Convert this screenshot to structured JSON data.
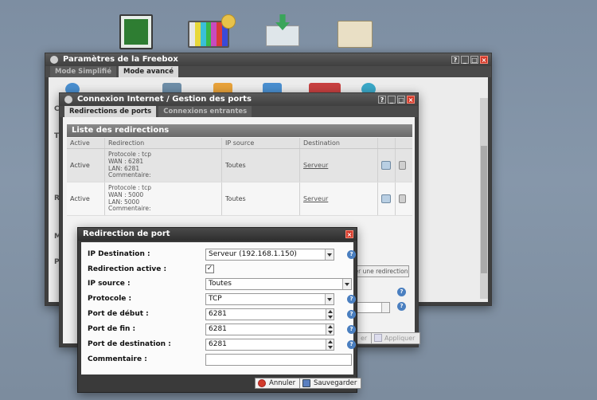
{
  "desktop": {
    "icons": [
      "monitor-icon",
      "tv-icon",
      "mail-download-icon",
      "folder-icon"
    ]
  },
  "freebox_window": {
    "title": "Paramètres de la Freebox",
    "tabs": [
      "Mode Simplifié",
      "Mode avancé"
    ],
    "controls": [
      "?",
      "_",
      "□",
      "×"
    ],
    "side_letters": [
      "C",
      "T",
      "R",
      "M",
      "P"
    ]
  },
  "connexion_window": {
    "title": "Connexion Internet / Gestion des ports",
    "tabs": [
      "Redirections de ports",
      "Connexions entrantes"
    ],
    "controls": [
      "?",
      "_",
      "□",
      "×"
    ],
    "section_title": "Liste des redirections",
    "columns": [
      "Active",
      "Redirection",
      "IP source",
      "Destination"
    ],
    "rows": [
      {
        "active": "Active",
        "redirection": [
          "Protocole : tcp",
          "WAN : 6281",
          "LAN: 6281",
          "Commentaire:"
        ],
        "ip_source": "Toutes",
        "destination": "Serveur"
      },
      {
        "active": "Active",
        "redirection": [
          "Protocole : tcp",
          "WAN : 5000",
          "LAN: 5000",
          "Commentaire:"
        ],
        "ip_source": "Toutes",
        "destination": "Serveur"
      }
    ],
    "add_button": "er une redirection",
    "cancel_partial": "er",
    "apply_button": "Appliquer"
  },
  "dialog": {
    "title": "Redirection de port",
    "fields": {
      "ip_destination": {
        "label": "IP Destination :",
        "value": "Serveur (192.168.1.150)"
      },
      "redirection_active": {
        "label": "Redirection active :",
        "checked": "✓"
      },
      "ip_source": {
        "label": "IP source :",
        "value": "Toutes"
      },
      "protocole": {
        "label": "Protocole :",
        "value": "TCP"
      },
      "port_debut": {
        "label": "Port de début :",
        "value": "6281"
      },
      "port_fin": {
        "label": "Port de fin :",
        "value": "6281"
      },
      "port_destination": {
        "label": "Port de destination :",
        "value": "6281"
      },
      "commentaire": {
        "label": "Commentaire :",
        "value": ""
      }
    },
    "help": "?",
    "buttons": {
      "cancel": "Annuler",
      "save": "Sauvegarder"
    }
  }
}
